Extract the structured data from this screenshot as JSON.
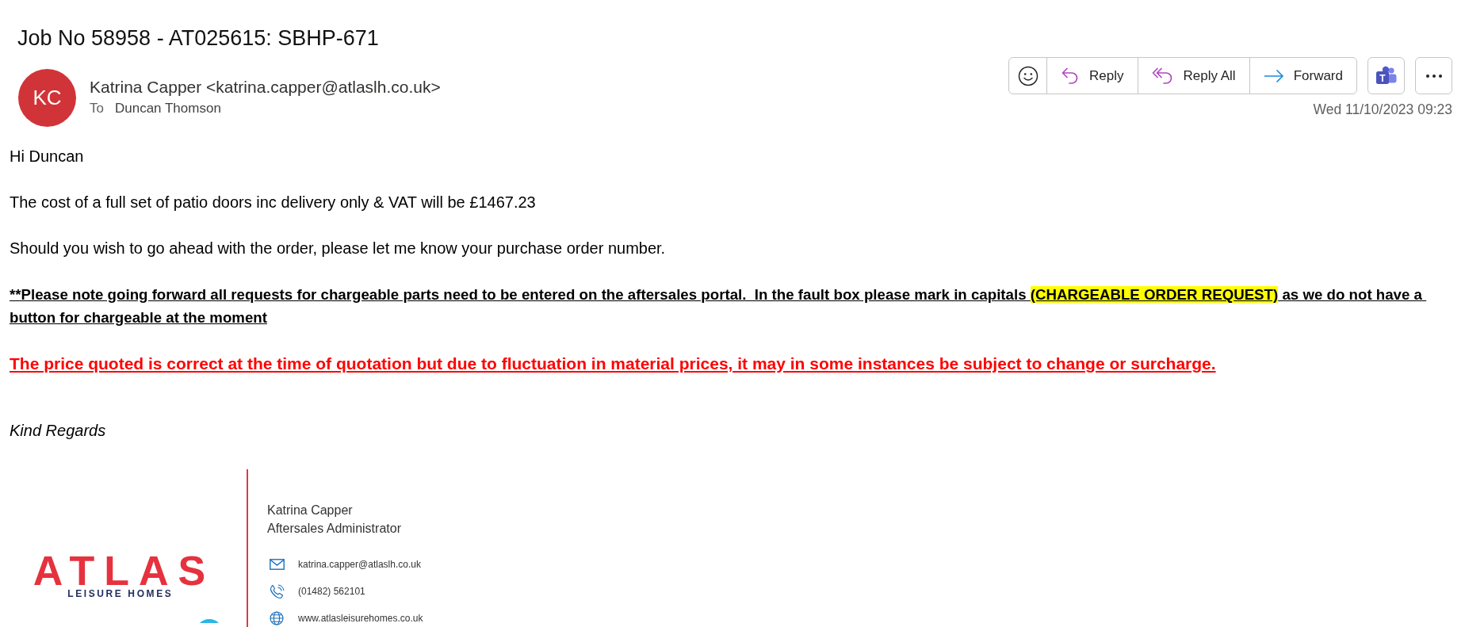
{
  "subject": "Job No 58958 - AT025615: SBHP-671",
  "sender": {
    "initials": "KC",
    "from": "Katrina Capper <katrina.capper@atlaslh.co.uk>",
    "to_label": "To",
    "recipient": "Duncan Thomson"
  },
  "actions": [
    {
      "kind": "emoji"
    },
    {
      "kind": "reply",
      "label": "Reply"
    },
    {
      "kind": "reply_all",
      "label": "Reply All"
    },
    {
      "kind": "forward",
      "label": "Forward"
    }
  ],
  "side_buttons": [
    {
      "kind": "app",
      "letter": "T"
    },
    {
      "kind": "more"
    }
  ],
  "date": "Wed 11/10/2023 09:23",
  "body": [
    {
      "kind": "plain",
      "text": "Hi Duncan"
    },
    {
      "kind": "plain",
      "text": "The cost of a full set of patio doors inc delivery only & VAT will be £1467.23"
    },
    {
      "kind": "plain",
      "text": "Should you wish to go ahead with the order, please let me know your purchase order number."
    },
    {
      "kind": "notice",
      "segments": [
        {
          "text": "**Please note going forward all requests for chargeable parts need to be entered on the aftersales portal.  In the fault box please mark in capitals ",
          "highlighted": false
        },
        {
          "text": "(CHARGEABLE ORDER REQUEST)",
          "highlighted": true
        },
        {
          "text": " as we do not have a button for chargeable at the moment",
          "highlighted": false
        }
      ]
    },
    {
      "kind": "warning",
      "text": "The price quoted is correct at the time of quotation but due to fluctuation in material prices, it may in some instances be subject to change or surcharge."
    },
    {
      "kind": "closing",
      "text": "Kind Regards"
    }
  ],
  "signature": {
    "logo_word": "ATLAS",
    "logo_tagline": "LEISURE HOMES",
    "name": "Katrina Capper",
    "role": "Aftersales Administrator",
    "contacts": [
      {
        "kind": "email",
        "text": "katrina.capper@atlaslh.co.uk"
      },
      {
        "kind": "phone",
        "text": "(01482) 562101"
      },
      {
        "kind": "web",
        "text": "www.atlasleisurehomes.co.uk"
      }
    ]
  }
}
